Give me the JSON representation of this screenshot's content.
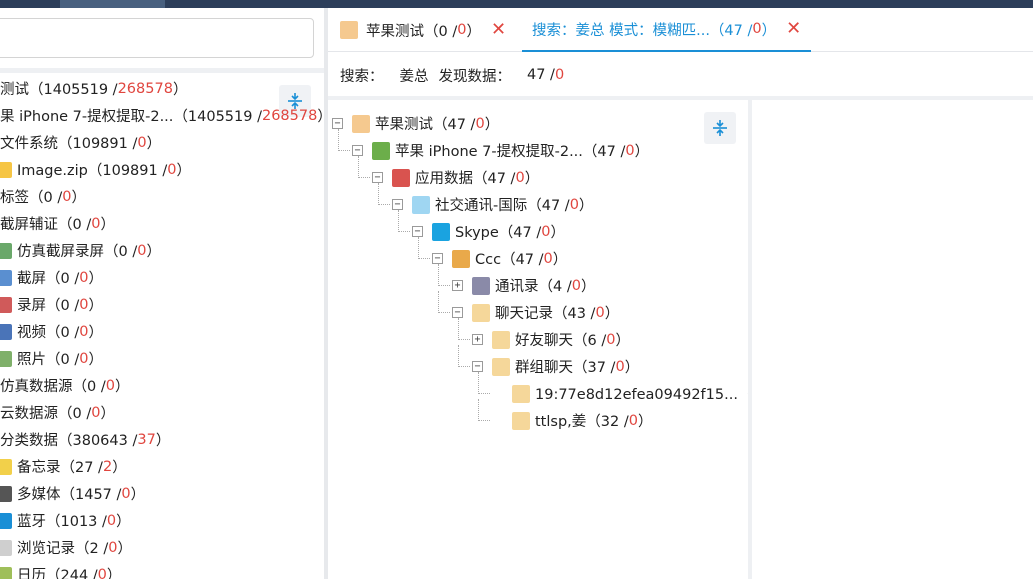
{
  "left_tree": [
    {
      "label": "测试",
      "count": "1405519",
      "red": "268578",
      "icon": "none",
      "x": 0
    },
    {
      "label": "果 iPhone 7-提权提取-2...",
      "count": "1405519",
      "red": "268578",
      "icon": "none",
      "x": 0
    },
    {
      "label": "文件系统",
      "count": "109891",
      "red": "0",
      "icon": "none",
      "x": 0
    },
    {
      "label": "Image.zip",
      "count": "109891",
      "red": "0",
      "icon": "folder-icon",
      "x": 0
    },
    {
      "label": "标签",
      "count": "0",
      "red": "0",
      "icon": "none",
      "x": 0
    },
    {
      "label": "截屏辅证",
      "count": "0",
      "red": "0",
      "icon": "none",
      "x": 0
    },
    {
      "label": "仿真截屏录屏",
      "count": "0",
      "red": "0",
      "icon": "image-icon",
      "x": 0
    },
    {
      "label": "截屏",
      "count": "0",
      "red": "0",
      "icon": "screen-icon",
      "x": 0
    },
    {
      "label": "录屏",
      "count": "0",
      "red": "0",
      "icon": "record-icon",
      "x": 0
    },
    {
      "label": "视频",
      "count": "0",
      "red": "0",
      "icon": "video-icon",
      "x": 0
    },
    {
      "label": "照片",
      "count": "0",
      "red": "0",
      "icon": "photo-icon",
      "x": 0
    },
    {
      "label": "仿真数据源",
      "count": "0",
      "red": "0",
      "icon": "none",
      "x": 0
    },
    {
      "label": "云数据源",
      "count": "0",
      "red": "0",
      "icon": "none",
      "x": 0
    },
    {
      "label": "分类数据",
      "count": "380643",
      "red": "37",
      "icon": "none",
      "x": 0
    },
    {
      "label": "备忘录",
      "count": "27",
      "red": "2",
      "icon": "notes-icon",
      "x": 0
    },
    {
      "label": "多媒体",
      "count": "1457",
      "red": "0",
      "icon": "media-icon",
      "x": 0
    },
    {
      "label": "蓝牙",
      "count": "1013",
      "red": "0",
      "icon": "bluetooth-icon",
      "x": 0
    },
    {
      "label": "浏览记录",
      "count": "2",
      "red": "0",
      "icon": "browser-icon",
      "x": 0
    },
    {
      "label": "日历",
      "count": "244",
      "red": "0",
      "icon": "calendar-icon",
      "x": 0
    }
  ],
  "tabs": [
    {
      "label": "苹果测试（0 / ",
      "red": "0",
      "suffix": "）"
    },
    {
      "label": "搜索：姜总  模式：模糊匹...（47 / ",
      "red": "0",
      "suffix": "）"
    }
  ],
  "info": {
    "search_label": "搜索：",
    "search_value": "姜总",
    "found_label": "发现数据：",
    "found_count": "47 /",
    "found_red": "0"
  },
  "result_tree": [
    {
      "label": "苹果测试（47 / ",
      "red": "0",
      "icon": "case-icon",
      "toggle": "-"
    },
    {
      "label": "苹果 iPhone 7-提权提取-2...（47 / ",
      "red": "0",
      "icon": "phone-icon",
      "toggle": "-"
    },
    {
      "label": "应用数据（47 / ",
      "red": "0",
      "icon": "app-data-icon",
      "toggle": "-"
    },
    {
      "label": "社交通讯-国际（47 / ",
      "red": "0",
      "icon": "social-icon",
      "toggle": "-"
    },
    {
      "label": "Skype（47 / ",
      "red": "0",
      "icon": "skype-icon",
      "toggle": "-"
    },
    {
      "label": "Ccc（47 / ",
      "red": "0",
      "icon": "user-icon",
      "toggle": "-"
    },
    {
      "label": "通讯录（4 / ",
      "red": "0",
      "icon": "contacts-icon",
      "toggle": "+"
    },
    {
      "label": "聊天记录（43 / ",
      "red": "0",
      "icon": "chat-icon",
      "toggle": "-"
    },
    {
      "label": "好友聊天（6 / ",
      "red": "0",
      "icon": "chat-icon",
      "toggle": "+"
    },
    {
      "label": "群组聊天（37 / ",
      "red": "0",
      "icon": "chat-icon",
      "toggle": "-"
    },
    {
      "label": "19:77e8d12efea09492f15...（",
      "red": "",
      "icon": "chat-icon",
      "toggle": ""
    },
    {
      "label": "ttlsp,姜（32 / ",
      "red": "0",
      "icon": "chat-icon",
      "toggle": ""
    }
  ],
  "colors": {
    "accent": "#1a8fd6",
    "alert": "#e0463f"
  }
}
